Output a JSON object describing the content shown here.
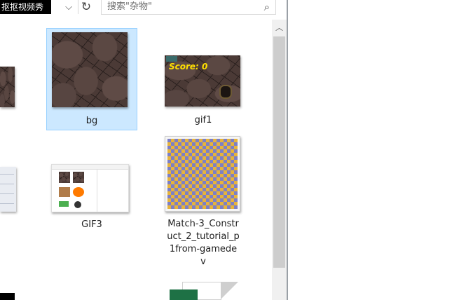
{
  "header": {
    "folder_title": "抠抠视频秀",
    "dropdown_glyph": "⌵",
    "refresh_glyph": "↻",
    "search_placeholder": "搜索\"杂物\"",
    "search_glyph": "⌕"
  },
  "scrollbar": {
    "up_glyph": "︿"
  },
  "files": [
    {
      "name": "bg",
      "kind": "image",
      "selected": true
    },
    {
      "name": "gif1",
      "kind": "image",
      "overlay_text": "Score: 0"
    },
    {
      "name": "GIF3",
      "kind": "image"
    },
    {
      "name": "Match-3_Construct_2_tutorial_p1from-gamedev",
      "kind": "image",
      "label_lines": [
        "Match-3_Constr",
        "uct_2_tutorial_p",
        "1from-gamede",
        "v"
      ]
    }
  ],
  "colors": {
    "selection_fill": "#cce8ff",
    "selection_border": "#99d1ff",
    "score_text": "#ffe000",
    "excel_green": "#1e7145"
  }
}
